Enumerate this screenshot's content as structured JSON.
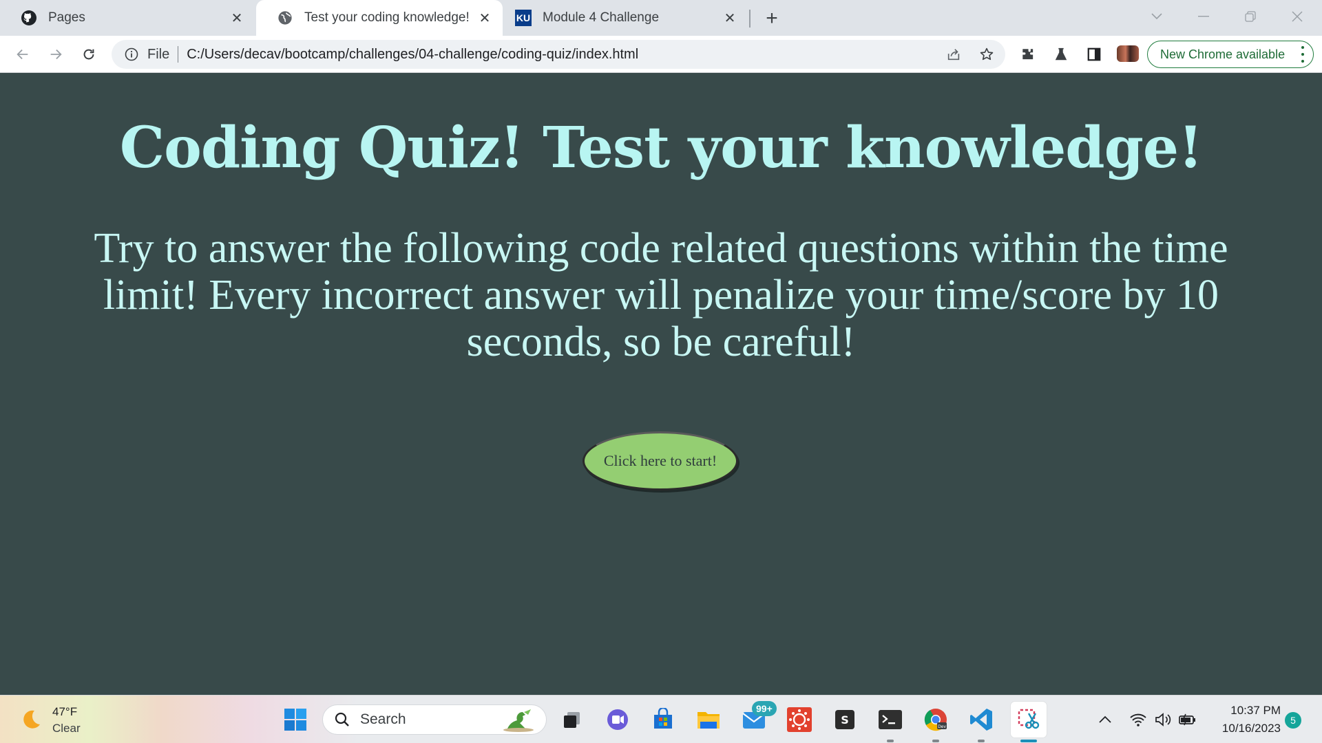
{
  "browser": {
    "tabs": [
      {
        "label": "Pages",
        "icon": "github-icon"
      },
      {
        "label": "Test your coding knowledge!",
        "icon": "globe-icon",
        "active": true
      },
      {
        "label": "Module 4 Challenge",
        "icon": "ku-icon",
        "favicon_text": "KU"
      }
    ],
    "address": {
      "scheme_label": "File",
      "url": "C:/Users/decav/bootcamp/challenges/04-challenge/coding-quiz/index.html"
    },
    "update_pill_label": "New Chrome available"
  },
  "page": {
    "title": "Coding Quiz! Test your knowledge!",
    "intro": "Try to answer the following code related questions within the time limit! Every incorrect answer will penalize your time/score by 10 seconds, so be careful!",
    "start_button": "Click here to start!",
    "colors": {
      "background": "#384a4a",
      "heading": "#b8f5f2",
      "button": "#94ce72"
    }
  },
  "taskbar": {
    "weather": {
      "temp": "47°F",
      "condition": "Clear"
    },
    "search_label": "Search",
    "mail_badge": "99+",
    "clock": {
      "time": "10:37 PM",
      "date": "10/16/2023"
    },
    "notifications": "5"
  }
}
